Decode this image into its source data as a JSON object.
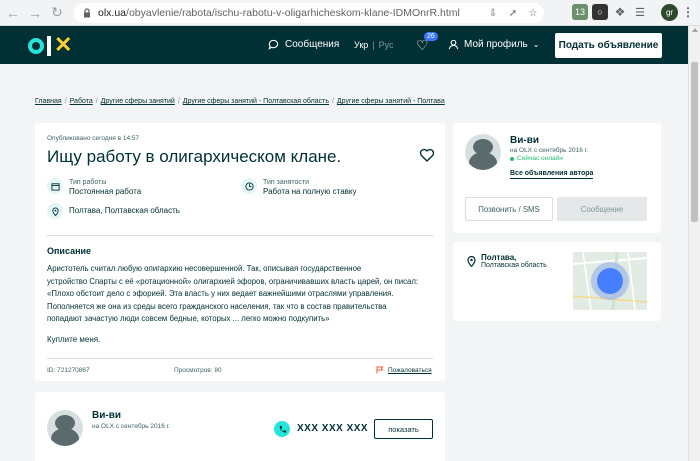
{
  "browser": {
    "url_host": "olx.ua",
    "url_path": "/obyavlenie/rabota/ischu-rabotu-v-oligarhicheskom-klane-IDMOnrR.html",
    "ext_badge": "13",
    "profile_initials": "gr"
  },
  "header": {
    "messages_label": "Сообщения",
    "lang_ukr": "Укр",
    "lang_rus": "Рус",
    "favorites_count": "26",
    "profile_label": "Мой профиль",
    "post_button_label": "Подать объявление"
  },
  "breadcrumb": [
    "Главная",
    "Работа",
    "Другие сферы занятий",
    "Другие сферы занятий - Полтавская область",
    "Другие сферы занятий - Полтава"
  ],
  "ad": {
    "published": "Опубликовано сегодня в 14:57",
    "title": "Ищу работу в олигархическом клане.",
    "job_type_label": "Тип работы",
    "job_type_value": "Постоянная работа",
    "employment_label": "Тип занятости",
    "employment_value": "Работа на полную ставку",
    "location": "Полтава, Полтавская область",
    "description_heading": "Описание",
    "description_lines": [
      "Аристотель считал любую олигархию несовершенной. Так, описывая государственное",
      "устройство Спарты с её «ротационной» олигархией эфоров, ограничивавших власть царей, он писал:",
      "«Плохо обстоит дело с эфорией. Эта власть у них ведает важнейшими отраслями управления.",
      "Пополняется же она из среды всего гражданского населения, так что в состав правительства",
      "попадают зачастую люди совсем бедные, которых ... легко можно подкупить»"
    ],
    "description_end": "Куплите меня.",
    "id_text": "ID: 721270867",
    "views_text": "Просмотров: 80",
    "report_label": "Пожаловаться"
  },
  "seller": {
    "name": "Ви-ви",
    "since": "на OLX с сентябрь 2016 г.",
    "online": "Сейчас онлайн",
    "all_ads_label": "Все объявления автора",
    "call_button": "Позвонить / SMS",
    "message_button": "Сообщение"
  },
  "location_card": {
    "city": "Полтава,",
    "region": "Полтавская область"
  },
  "bottom": {
    "name": "Ви-ви",
    "since": "на OLX с сентябрь 2016 г.",
    "phone": "XXX XXX XXX",
    "show_button": "показать"
  },
  "colors": {
    "brand_dark": "#002f34",
    "brand_teal": "#23e5db",
    "online_green": "#23bd6c"
  }
}
